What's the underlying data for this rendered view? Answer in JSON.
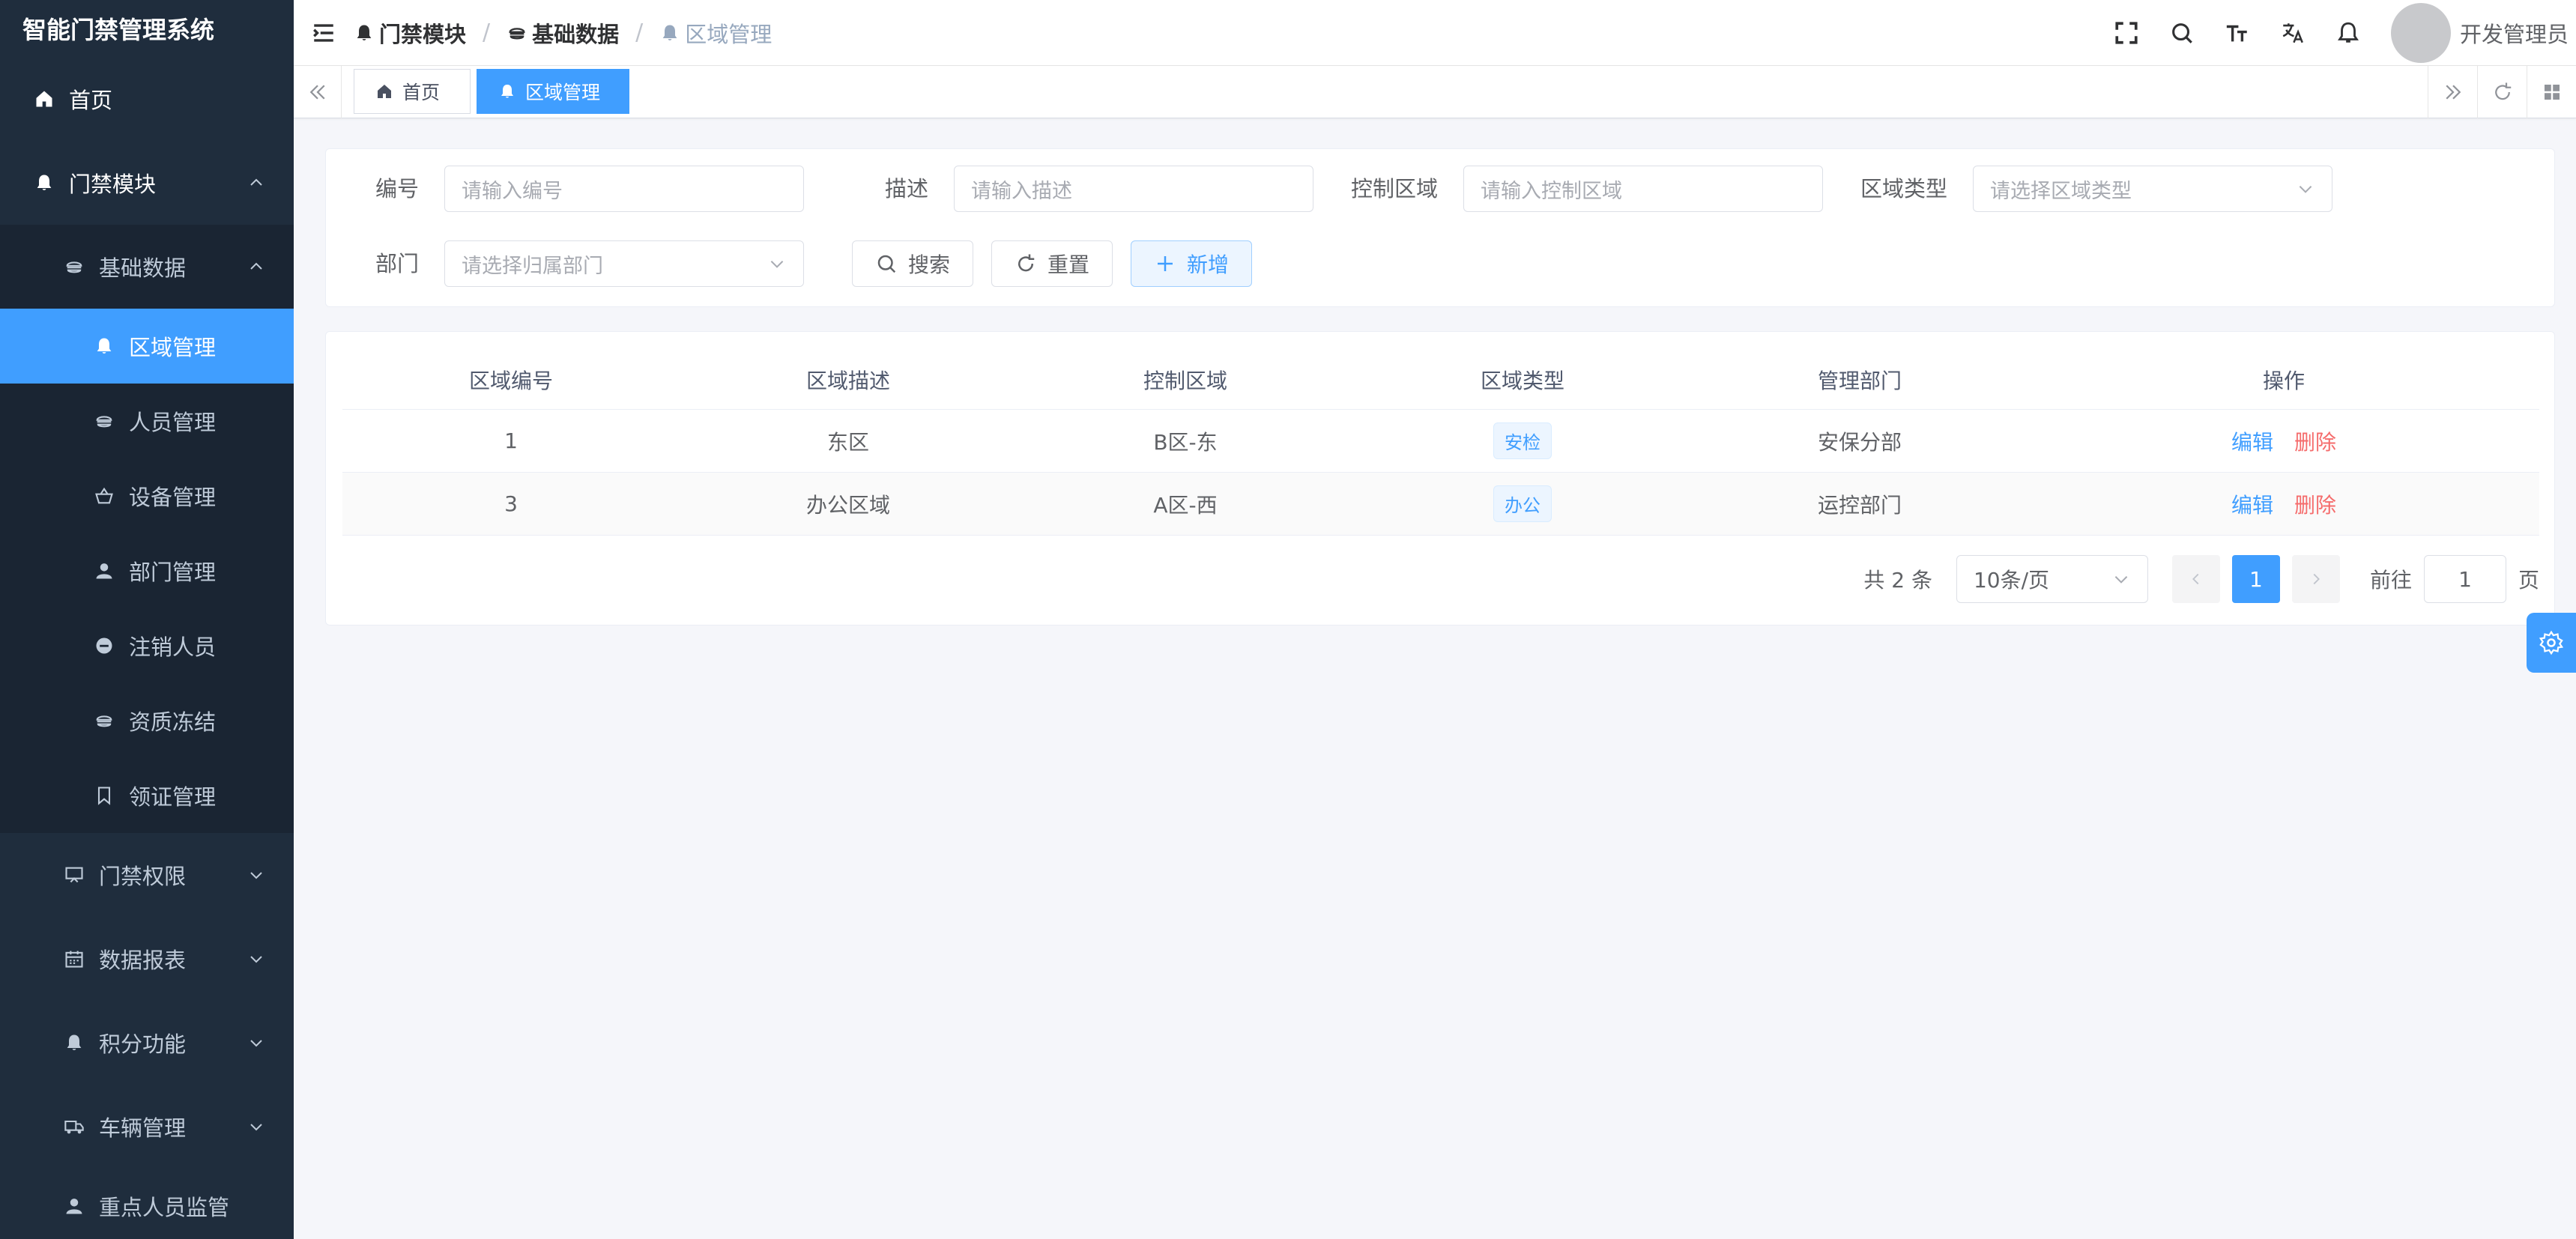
{
  "app": {
    "title": "智能门禁管理系统"
  },
  "sidebar": {
    "home": "首页",
    "access_module": "门禁模块",
    "basic_data": "基础数据",
    "items": [
      {
        "label": "区域管理",
        "icon": "bell-icon"
      },
      {
        "label": "人员管理",
        "icon": "hamburger-food-icon"
      },
      {
        "label": "设备管理",
        "icon": "basket-icon"
      },
      {
        "label": "部门管理",
        "icon": "user-icon"
      },
      {
        "label": "注销人员",
        "icon": "remove-circle-icon"
      },
      {
        "label": "资质冻结",
        "icon": "hamburger-food-icon"
      },
      {
        "label": "领证管理",
        "icon": "bookmark-icon"
      }
    ],
    "groups": [
      {
        "label": "门禁权限",
        "icon": "monitor-icon"
      },
      {
        "label": "数据报表",
        "icon": "calendar-icon"
      },
      {
        "label": "积分功能",
        "icon": "bell-icon"
      },
      {
        "label": "车辆管理",
        "icon": "truck-icon"
      },
      {
        "label": "重点人员监管",
        "icon": "user-icon"
      }
    ]
  },
  "header": {
    "breadcrumb": [
      "门禁模块",
      "基础数据",
      "区域管理"
    ],
    "username": "开发管理员"
  },
  "tags": {
    "home": "首页",
    "current": "区域管理"
  },
  "search": {
    "code_label": "编号",
    "code_placeholder": "请输入编号",
    "desc_label": "描述",
    "desc_placeholder": "请输入描述",
    "control_label": "控制区域",
    "control_placeholder": "请输入控制区域",
    "type_label": "区域类型",
    "type_placeholder": "请选择区域类型",
    "dept_label": "部门",
    "dept_placeholder": "请选择归属部门",
    "search_btn": "搜索",
    "reset_btn": "重置",
    "add_btn": "新增"
  },
  "table": {
    "headers": [
      "区域编号",
      "区域描述",
      "控制区域",
      "区域类型",
      "管理部门",
      "操作"
    ],
    "rows": [
      {
        "code": "1",
        "desc": "东区",
        "control": "B区-东",
        "type": "安检",
        "dept": "安保分部"
      },
      {
        "code": "3",
        "desc": "办公区域",
        "control": "A区-西",
        "type": "办公",
        "dept": "运控部门"
      }
    ],
    "edit": "编辑",
    "delete": "删除"
  },
  "pagination": {
    "total": "共 2 条",
    "page_size": "10条/页",
    "current": "1",
    "goto": "前往",
    "goto_value": "1",
    "page_unit": "页"
  },
  "colors": {
    "sidebar_bg": "#1f2d3d",
    "accent": "#409eff",
    "danger": "#f56c6c"
  }
}
